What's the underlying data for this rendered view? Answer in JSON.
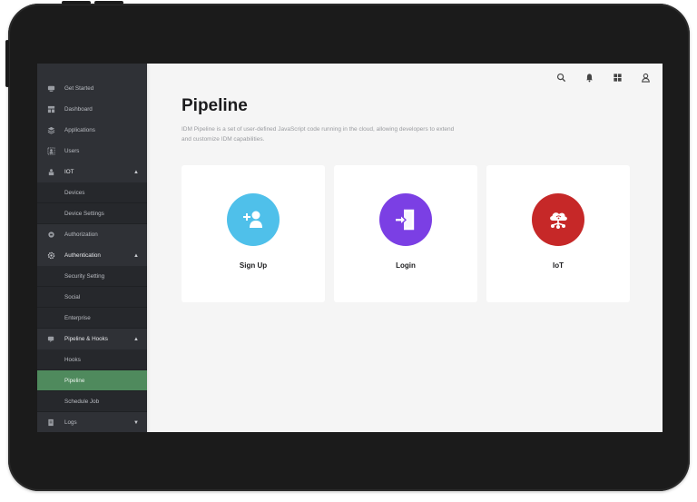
{
  "colors": {
    "sidebar_bg": "#2f3136",
    "active_item": "#4f8a5d",
    "signup_circle": "#4fc0ea",
    "login_circle": "#7b3fe4",
    "iot_circle": "#c62828"
  },
  "sidebar": {
    "items": [
      {
        "label": "Get Started",
        "icon": "rocket-icon"
      },
      {
        "label": "Dashboard",
        "icon": "dashboard-icon"
      },
      {
        "label": "Applications",
        "icon": "layers-icon"
      },
      {
        "label": "Users",
        "icon": "users-icon"
      },
      {
        "label": "IOT",
        "icon": "iot-icon",
        "chevron": "▲"
      },
      {
        "label": "Devices"
      },
      {
        "label": "Device Settings"
      },
      {
        "label": "Authorization",
        "icon": "authorization-icon"
      },
      {
        "label": "Authentication",
        "icon": "authentication-gear-icon",
        "chevron": "▲"
      },
      {
        "label": "Security Setting"
      },
      {
        "label": "Social"
      },
      {
        "label": "Enterprise"
      },
      {
        "label": "Pipeline & Hooks",
        "icon": "pipeline-icon",
        "chevron": "▲"
      },
      {
        "label": "Hooks"
      },
      {
        "label": "Pipeline"
      },
      {
        "label": "Schedule Job"
      },
      {
        "label": "Logs",
        "icon": "logs-icon",
        "chevron": "▼"
      }
    ]
  },
  "header": {
    "icons": [
      "search-icon",
      "bell-icon",
      "apps-grid-icon",
      "user-icon"
    ]
  },
  "main": {
    "title": "Pipeline",
    "description": "IDM Pipeline is a set of user-defined JavaScript code running in the cloud, allowing developers to extend and customize IDM capabilities.",
    "cards": [
      {
        "label": "Sign Up",
        "icon": "add-user-icon"
      },
      {
        "label": "Login",
        "icon": "login-door-icon"
      },
      {
        "label": "IoT",
        "icon": "iot-cloud-icon"
      }
    ]
  }
}
